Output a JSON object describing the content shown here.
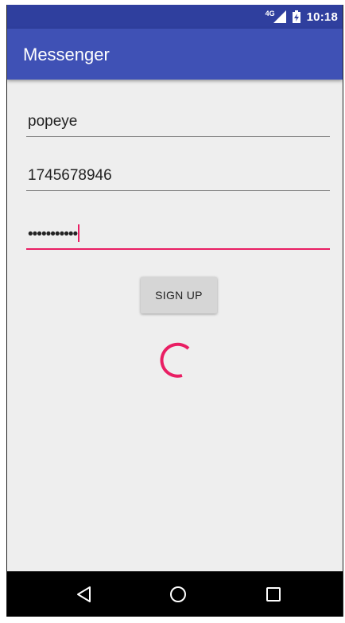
{
  "status_bar": {
    "network": "4G",
    "time": "10:18",
    "icons": [
      "signal-icon",
      "battery-charging-icon"
    ]
  },
  "app_bar": {
    "title": "Messenger"
  },
  "form": {
    "username": "popeye",
    "phone": "1745678946",
    "password_masked": "•••••••••••"
  },
  "actions": {
    "signup_label": "SIGN UP"
  },
  "nav_bar": {
    "icons": [
      "back-icon",
      "home-icon",
      "recents-icon"
    ]
  },
  "colors": {
    "status_bar": "#2f3f9e",
    "app_bar": "#3f51b5",
    "accent": "#e91e63",
    "background": "#eeeeee",
    "button": "#d6d6d6"
  }
}
